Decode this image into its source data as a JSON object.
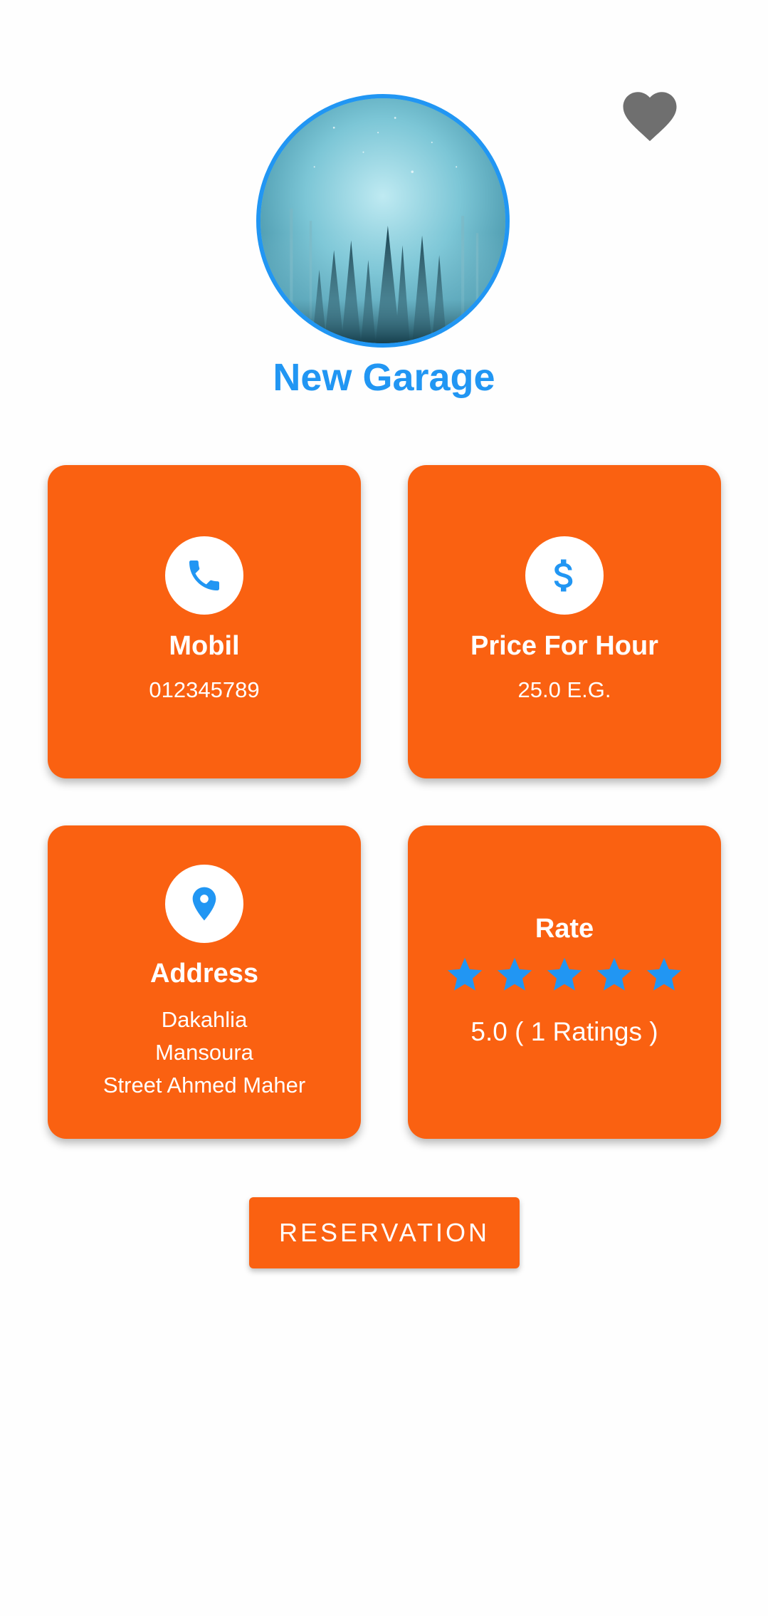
{
  "header": {
    "favorite_icon": "heart-icon",
    "favorite_color": "#6f6f6f",
    "avatar_image": "forest-night-photo"
  },
  "garage": {
    "name": "New Garage"
  },
  "cards": {
    "mobile": {
      "icon": "phone-icon",
      "title": "Mobil",
      "value": "012345789"
    },
    "price": {
      "icon": "dollar-icon",
      "title": "Price For Hour",
      "value": "25.0 E.G."
    },
    "address": {
      "icon": "location-pin-icon",
      "title": "Address",
      "lines": [
        "Dakahlia",
        "Mansoura",
        "Street Ahmed Maher"
      ]
    },
    "rate": {
      "title": "Rate",
      "stars_filled": 5,
      "stars_total": 5,
      "text": "5.0 ( 1 Ratings )"
    }
  },
  "actions": {
    "reservation_label": "RESERVATION"
  },
  "colors": {
    "accent": "#2196f3",
    "card": "#fa6111",
    "text_on_card": "#ffffff",
    "background": "#fefefe"
  }
}
